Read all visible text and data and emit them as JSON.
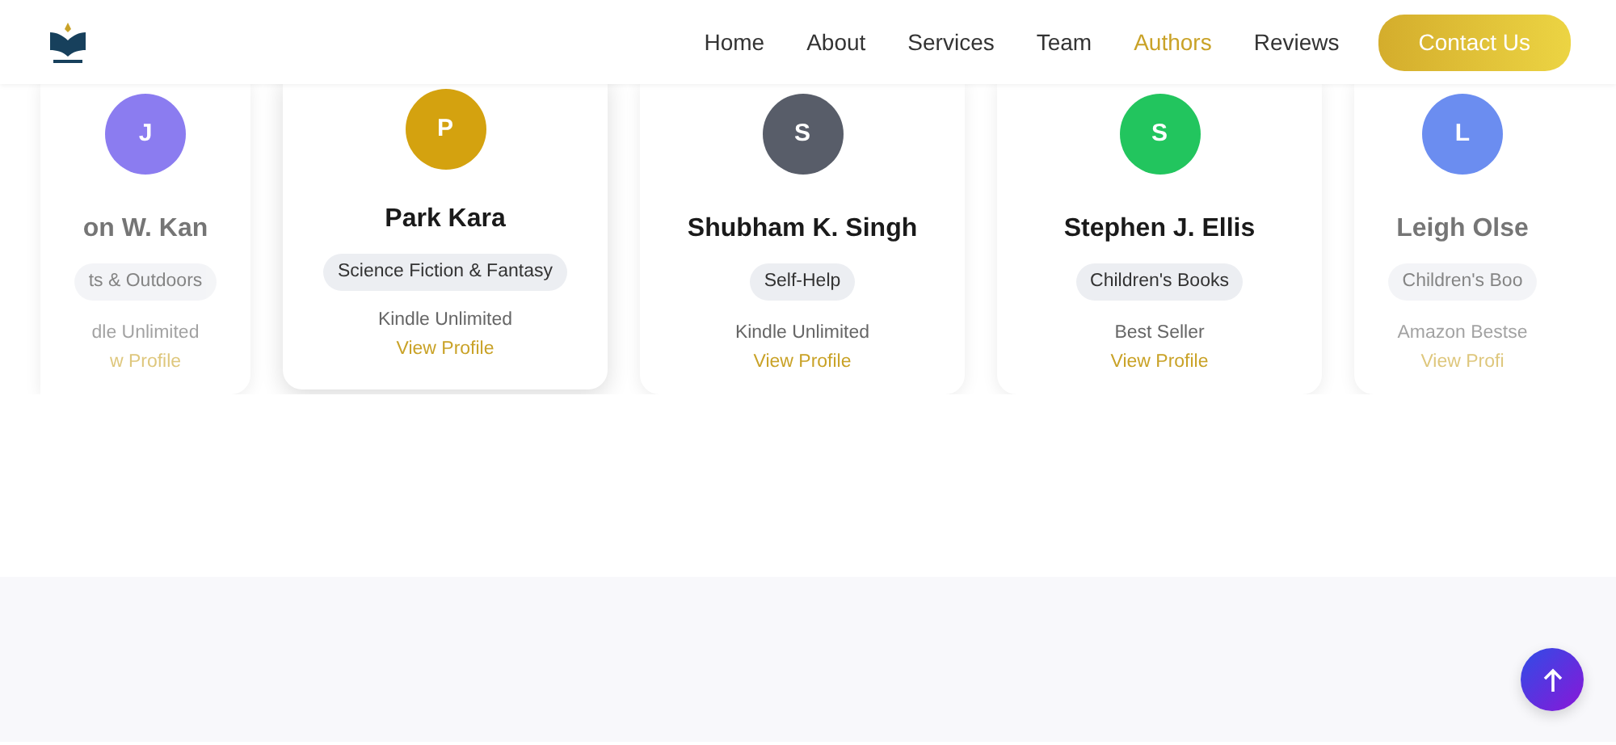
{
  "navbar": {
    "links": [
      {
        "label": "Home",
        "selected": false
      },
      {
        "label": "About",
        "selected": false
      },
      {
        "label": "Services",
        "selected": false
      },
      {
        "label": "Team",
        "selected": false
      },
      {
        "label": "Authors",
        "selected": true
      },
      {
        "label": "Reviews",
        "selected": false
      }
    ],
    "cta": "Contact Us"
  },
  "authors": [
    {
      "initial": "J",
      "color": "#8b7cf0",
      "name": "on W. Kan",
      "genre": "ts & Outdoors",
      "note": "dle Unlimited",
      "link": "w Profile",
      "faded": true,
      "hovered": false
    },
    {
      "initial": "P",
      "color": "#d4a20f",
      "name": "Park Kara",
      "genre": "Science Fiction & Fantasy",
      "note": "Kindle Unlimited",
      "link": "View Profile",
      "faded": false,
      "hovered": true
    },
    {
      "initial": "S",
      "color": "#585d69",
      "name": "Shubham K. Singh",
      "genre": "Self-Help",
      "note": "Kindle Unlimited",
      "link": "View Profile",
      "faded": false,
      "hovered": false
    },
    {
      "initial": "S",
      "color": "#22c55e",
      "name": "Stephen J. Ellis",
      "genre": "Children's Books",
      "note": "Best Seller",
      "link": "View Profile",
      "faded": false,
      "hovered": false
    },
    {
      "initial": "L",
      "color": "#6b8df0",
      "name": "Leigh Olse",
      "genre": "Children's Boo",
      "note": "Amazon Bestse",
      "link": "View Profi",
      "faded": true,
      "hovered": false
    }
  ]
}
